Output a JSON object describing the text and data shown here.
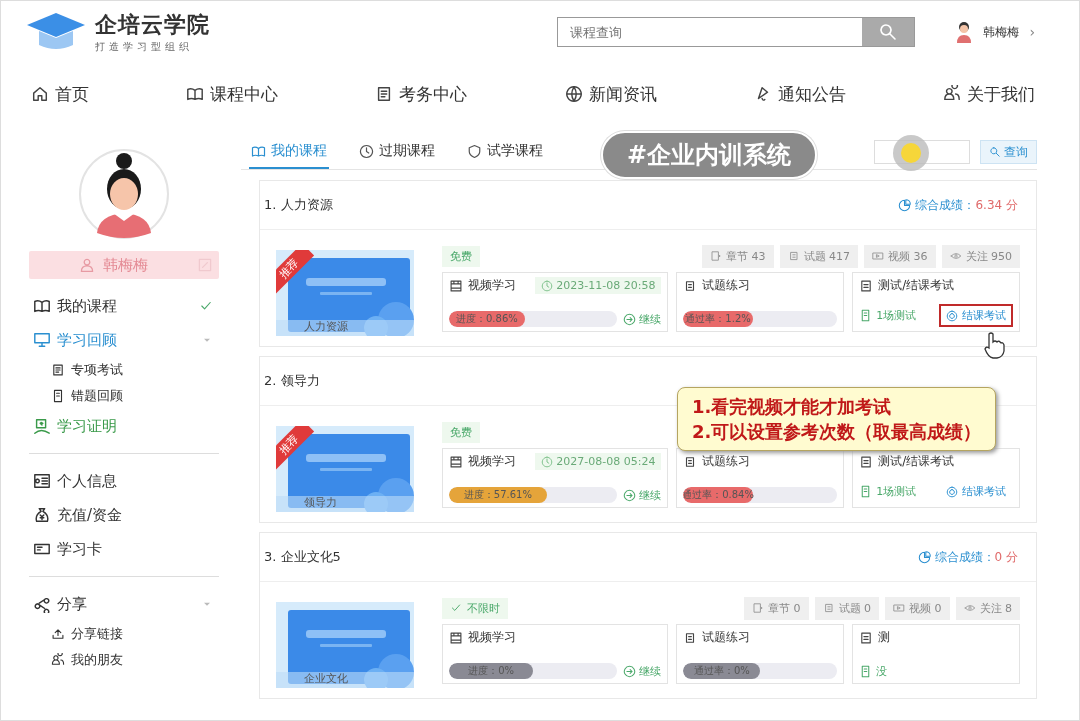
{
  "header": {
    "logo_title": "企培云学院",
    "logo_subtitle": "打造学习型组织",
    "search": {
      "placeholder": "课程查询"
    },
    "user": {
      "name": "韩梅梅",
      "chevron": "›"
    }
  },
  "nav": [
    {
      "label": "首页"
    },
    {
      "label": "课程中心"
    },
    {
      "label": "考务中心"
    },
    {
      "label": "新闻资讯"
    },
    {
      "label": "通知公告"
    },
    {
      "label": "关于我们"
    }
  ],
  "sidebar": {
    "user_name": "韩梅梅",
    "sections": [
      [
        {
          "label": "我的课程",
          "selected": true,
          "expanded": false,
          "color": "#333333"
        },
        {
          "label": "学习回顾",
          "selected": false,
          "expanded": true,
          "color": "#2a8fd0",
          "children": [
            {
              "label": "专项考试"
            },
            {
              "label": "错题回顾"
            }
          ]
        },
        {
          "label": "学习证明",
          "selected": false,
          "expanded": false,
          "color": "#3a9a4a"
        }
      ],
      [
        {
          "label": "个人信息",
          "selected": false,
          "expanded": false,
          "color": "#333333"
        },
        {
          "label": "充值/资金",
          "selected": false,
          "expanded": false,
          "color": "#333333"
        },
        {
          "label": "学习卡",
          "selected": false,
          "expanded": false,
          "color": "#333333"
        }
      ],
      [
        {
          "label": "分享",
          "selected": false,
          "expanded": true,
          "color": "#333333",
          "children": [
            {
              "label": "分享链接"
            },
            {
              "label": "我的朋友"
            }
          ]
        }
      ]
    ]
  },
  "tabs": [
    {
      "label": "我的课程",
      "selected": true
    },
    {
      "label": "过期课程",
      "selected": false
    },
    {
      "label": "试学课程",
      "selected": false
    }
  ],
  "course_search": {
    "button": "查询"
  },
  "courses": [
    {
      "title": "1. 人力资源",
      "score": "综合成绩：",
      "score_value": "6.34 分",
      "ribbon": "推荐",
      "cover_label": "人力资源",
      "tag": {
        "kind": "free",
        "label": "免费"
      },
      "stats": [
        {
          "label": "章节 43"
        },
        {
          "label": "试题 417"
        },
        {
          "label": "视频 36"
        },
        {
          "label": "关注 950"
        }
      ],
      "video": {
        "title": "视频学习",
        "date": "2023-11-08 20:58",
        "progress": "进度：0.86%",
        "level": 0.45,
        "color": "#e86a6a",
        "action": "继续"
      },
      "practice": {
        "title": "试题练习",
        "progress": "通过率：1.2%",
        "level": 0.45,
        "color": "#e86a6a"
      },
      "exam": {
        "title": "测试/结课考试",
        "tests": "1场测试",
        "button": "结课考试",
        "highlighted": true
      }
    },
    {
      "title": "2. 领导力",
      "ribbon": "推荐",
      "cover_label": "领导力",
      "tag": {
        "kind": "free",
        "label": "免费"
      },
      "video": {
        "title": "视频学习",
        "date": "2027-08-08 05:24",
        "progress": "进度：57.61%",
        "level": 0.58,
        "color": "#e5a43a",
        "action": "继续"
      },
      "practice": {
        "title": "试题练习",
        "progress": "通过率：0.84%",
        "level": 0.45,
        "color": "#e86a6a"
      },
      "exam": {
        "title": "测试/结课考试",
        "tests": "1场测试",
        "button": "结课考试",
        "highlighted": false
      }
    },
    {
      "title": "3. 企业文化5",
      "score": "综合成绩：",
      "score_value": "0 分",
      "cover_label": "企业文化",
      "tag": {
        "kind": "unlimited",
        "label": "不限时"
      },
      "stats": [
        {
          "label": "章节 0"
        },
        {
          "label": "试题 0"
        },
        {
          "label": "视频 0"
        },
        {
          "label": "关注 8"
        }
      ],
      "video": {
        "title": "视频学习",
        "progress": "进度：0%",
        "level": 0.5,
        "color": "#8a8a94",
        "action": "继续"
      },
      "practice": {
        "title": "试题练习",
        "progress": "通过率：0%",
        "level": 0.5,
        "color": "#8a8a94"
      },
      "exam": {
        "title": "测",
        "tests": "没"
      }
    }
  ],
  "caption": "#企业内训系统",
  "callout": [
    "1.看完视频才能才加考试",
    "2.可以设置参考次数（取最高成绩）"
  ]
}
